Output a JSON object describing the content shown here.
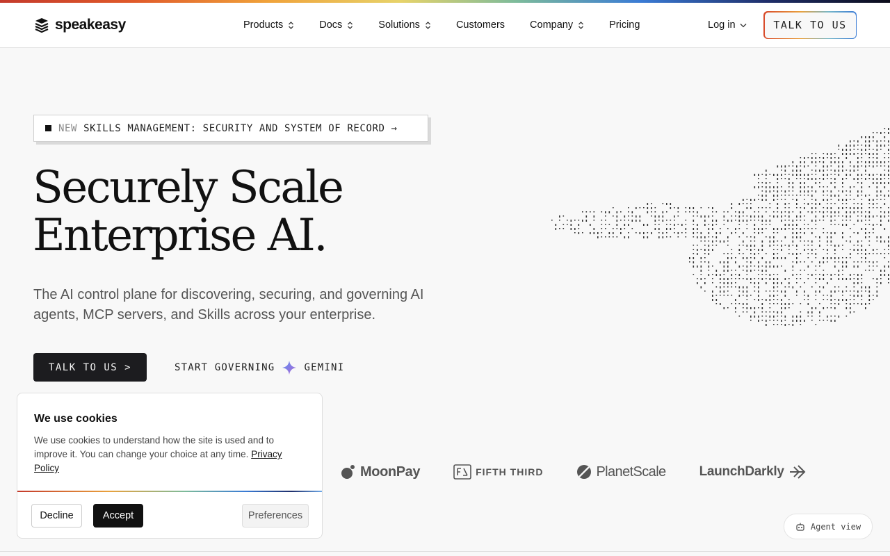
{
  "brand": {
    "name": "speakeasy"
  },
  "nav": {
    "items": [
      {
        "label": "Products",
        "has_menu": true
      },
      {
        "label": "Docs",
        "has_menu": true
      },
      {
        "label": "Solutions",
        "has_menu": true
      },
      {
        "label": "Customers",
        "has_menu": false
      },
      {
        "label": "Company",
        "has_menu": true
      },
      {
        "label": "Pricing",
        "has_menu": false
      }
    ],
    "login_label": "Log in",
    "cta_label": "TALK TO US"
  },
  "announcement": {
    "tag": "NEW",
    "text": "SKILLS MANAGEMENT: SECURITY AND SYSTEM OF RECORD",
    "arrow": "→"
  },
  "hero": {
    "title_line1": "Securely Scale",
    "title_line2": "Enterprise AI.",
    "subtitle": "The AI control plane for discovering, securing, and governing AI agents, MCP servers, and Skills across your enterprise.",
    "cta_label": "TALK TO US >",
    "secondary_label": "START GOVERNING",
    "secondary_product": "GEMINI"
  },
  "customer_logos": [
    "MoonPay",
    "FIFTH THIRD",
    "PlanetScale",
    "LaunchDarkly"
  ],
  "agent_view_label": "Agent view",
  "cookie_banner": {
    "title": "We use cookies",
    "body": "We use cookies to understand how the site is used and to improve it. You can change your choice at any time.",
    "link_label": "Privacy Policy",
    "decline_label": "Decline",
    "accept_label": "Accept",
    "preferences_label": "Preferences"
  },
  "colors": {
    "text": "#111111",
    "muted": "#555555",
    "dark_button": "#1c1c1f",
    "background": "#f8f8f8",
    "gemini_star": "#8a6cd6"
  }
}
